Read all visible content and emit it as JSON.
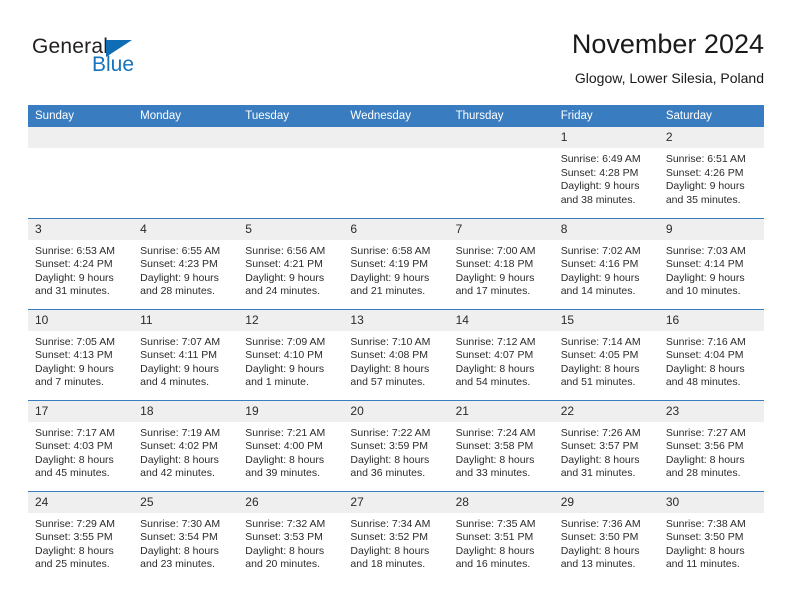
{
  "brand": {
    "name_part1": "General",
    "name_part2": "Blue",
    "triangle_color": "#0e6db5",
    "text_color": "#231f20",
    "blue_color": "#1673bd"
  },
  "header": {
    "title": "November 2024",
    "subtitle": "Glogow, Lower Silesia, Poland"
  },
  "theme": {
    "header_band": "#3a7cc0",
    "daynum_band": "#efefef",
    "text": "#2b2b2b"
  },
  "weekday_headers": [
    "Sunday",
    "Monday",
    "Tuesday",
    "Wednesday",
    "Thursday",
    "Friday",
    "Saturday"
  ],
  "weeks": [
    [
      {
        "day": "",
        "empty": true,
        "sunrise": "",
        "sunset": "",
        "daylight1": "",
        "daylight2": ""
      },
      {
        "day": "",
        "empty": true,
        "sunrise": "",
        "sunset": "",
        "daylight1": "",
        "daylight2": ""
      },
      {
        "day": "",
        "empty": true,
        "sunrise": "",
        "sunset": "",
        "daylight1": "",
        "daylight2": ""
      },
      {
        "day": "",
        "empty": true,
        "sunrise": "",
        "sunset": "",
        "daylight1": "",
        "daylight2": ""
      },
      {
        "day": "",
        "empty": true,
        "sunrise": "",
        "sunset": "",
        "daylight1": "",
        "daylight2": ""
      },
      {
        "day": "1",
        "empty": false,
        "sunrise": "Sunrise: 6:49 AM",
        "sunset": "Sunset: 4:28 PM",
        "daylight1": "Daylight: 9 hours",
        "daylight2": "and 38 minutes."
      },
      {
        "day": "2",
        "empty": false,
        "sunrise": "Sunrise: 6:51 AM",
        "sunset": "Sunset: 4:26 PM",
        "daylight1": "Daylight: 9 hours",
        "daylight2": "and 35 minutes."
      }
    ],
    [
      {
        "day": "3",
        "empty": false,
        "sunrise": "Sunrise: 6:53 AM",
        "sunset": "Sunset: 4:24 PM",
        "daylight1": "Daylight: 9 hours",
        "daylight2": "and 31 minutes."
      },
      {
        "day": "4",
        "empty": false,
        "sunrise": "Sunrise: 6:55 AM",
        "sunset": "Sunset: 4:23 PM",
        "daylight1": "Daylight: 9 hours",
        "daylight2": "and 28 minutes."
      },
      {
        "day": "5",
        "empty": false,
        "sunrise": "Sunrise: 6:56 AM",
        "sunset": "Sunset: 4:21 PM",
        "daylight1": "Daylight: 9 hours",
        "daylight2": "and 24 minutes."
      },
      {
        "day": "6",
        "empty": false,
        "sunrise": "Sunrise: 6:58 AM",
        "sunset": "Sunset: 4:19 PM",
        "daylight1": "Daylight: 9 hours",
        "daylight2": "and 21 minutes."
      },
      {
        "day": "7",
        "empty": false,
        "sunrise": "Sunrise: 7:00 AM",
        "sunset": "Sunset: 4:18 PM",
        "daylight1": "Daylight: 9 hours",
        "daylight2": "and 17 minutes."
      },
      {
        "day": "8",
        "empty": false,
        "sunrise": "Sunrise: 7:02 AM",
        "sunset": "Sunset: 4:16 PM",
        "daylight1": "Daylight: 9 hours",
        "daylight2": "and 14 minutes."
      },
      {
        "day": "9",
        "empty": false,
        "sunrise": "Sunrise: 7:03 AM",
        "sunset": "Sunset: 4:14 PM",
        "daylight1": "Daylight: 9 hours",
        "daylight2": "and 10 minutes."
      }
    ],
    [
      {
        "day": "10",
        "empty": false,
        "sunrise": "Sunrise: 7:05 AM",
        "sunset": "Sunset: 4:13 PM",
        "daylight1": "Daylight: 9 hours",
        "daylight2": "and 7 minutes."
      },
      {
        "day": "11",
        "empty": false,
        "sunrise": "Sunrise: 7:07 AM",
        "sunset": "Sunset: 4:11 PM",
        "daylight1": "Daylight: 9 hours",
        "daylight2": "and 4 minutes."
      },
      {
        "day": "12",
        "empty": false,
        "sunrise": "Sunrise: 7:09 AM",
        "sunset": "Sunset: 4:10 PM",
        "daylight1": "Daylight: 9 hours",
        "daylight2": "and 1 minute."
      },
      {
        "day": "13",
        "empty": false,
        "sunrise": "Sunrise: 7:10 AM",
        "sunset": "Sunset: 4:08 PM",
        "daylight1": "Daylight: 8 hours",
        "daylight2": "and 57 minutes."
      },
      {
        "day": "14",
        "empty": false,
        "sunrise": "Sunrise: 7:12 AM",
        "sunset": "Sunset: 4:07 PM",
        "daylight1": "Daylight: 8 hours",
        "daylight2": "and 54 minutes."
      },
      {
        "day": "15",
        "empty": false,
        "sunrise": "Sunrise: 7:14 AM",
        "sunset": "Sunset: 4:05 PM",
        "daylight1": "Daylight: 8 hours",
        "daylight2": "and 51 minutes."
      },
      {
        "day": "16",
        "empty": false,
        "sunrise": "Sunrise: 7:16 AM",
        "sunset": "Sunset: 4:04 PM",
        "daylight1": "Daylight: 8 hours",
        "daylight2": "and 48 minutes."
      }
    ],
    [
      {
        "day": "17",
        "empty": false,
        "sunrise": "Sunrise: 7:17 AM",
        "sunset": "Sunset: 4:03 PM",
        "daylight1": "Daylight: 8 hours",
        "daylight2": "and 45 minutes."
      },
      {
        "day": "18",
        "empty": false,
        "sunrise": "Sunrise: 7:19 AM",
        "sunset": "Sunset: 4:02 PM",
        "daylight1": "Daylight: 8 hours",
        "daylight2": "and 42 minutes."
      },
      {
        "day": "19",
        "empty": false,
        "sunrise": "Sunrise: 7:21 AM",
        "sunset": "Sunset: 4:00 PM",
        "daylight1": "Daylight: 8 hours",
        "daylight2": "and 39 minutes."
      },
      {
        "day": "20",
        "empty": false,
        "sunrise": "Sunrise: 7:22 AM",
        "sunset": "Sunset: 3:59 PM",
        "daylight1": "Daylight: 8 hours",
        "daylight2": "and 36 minutes."
      },
      {
        "day": "21",
        "empty": false,
        "sunrise": "Sunrise: 7:24 AM",
        "sunset": "Sunset: 3:58 PM",
        "daylight1": "Daylight: 8 hours",
        "daylight2": "and 33 minutes."
      },
      {
        "day": "22",
        "empty": false,
        "sunrise": "Sunrise: 7:26 AM",
        "sunset": "Sunset: 3:57 PM",
        "daylight1": "Daylight: 8 hours",
        "daylight2": "and 31 minutes."
      },
      {
        "day": "23",
        "empty": false,
        "sunrise": "Sunrise: 7:27 AM",
        "sunset": "Sunset: 3:56 PM",
        "daylight1": "Daylight: 8 hours",
        "daylight2": "and 28 minutes."
      }
    ],
    [
      {
        "day": "24",
        "empty": false,
        "sunrise": "Sunrise: 7:29 AM",
        "sunset": "Sunset: 3:55 PM",
        "daylight1": "Daylight: 8 hours",
        "daylight2": "and 25 minutes."
      },
      {
        "day": "25",
        "empty": false,
        "sunrise": "Sunrise: 7:30 AM",
        "sunset": "Sunset: 3:54 PM",
        "daylight1": "Daylight: 8 hours",
        "daylight2": "and 23 minutes."
      },
      {
        "day": "26",
        "empty": false,
        "sunrise": "Sunrise: 7:32 AM",
        "sunset": "Sunset: 3:53 PM",
        "daylight1": "Daylight: 8 hours",
        "daylight2": "and 20 minutes."
      },
      {
        "day": "27",
        "empty": false,
        "sunrise": "Sunrise: 7:34 AM",
        "sunset": "Sunset: 3:52 PM",
        "daylight1": "Daylight: 8 hours",
        "daylight2": "and 18 minutes."
      },
      {
        "day": "28",
        "empty": false,
        "sunrise": "Sunrise: 7:35 AM",
        "sunset": "Sunset: 3:51 PM",
        "daylight1": "Daylight: 8 hours",
        "daylight2": "and 16 minutes."
      },
      {
        "day": "29",
        "empty": false,
        "sunrise": "Sunrise: 7:36 AM",
        "sunset": "Sunset: 3:50 PM",
        "daylight1": "Daylight: 8 hours",
        "daylight2": "and 13 minutes."
      },
      {
        "day": "30",
        "empty": false,
        "sunrise": "Sunrise: 7:38 AM",
        "sunset": "Sunset: 3:50 PM",
        "daylight1": "Daylight: 8 hours",
        "daylight2": "and 11 minutes."
      }
    ]
  ]
}
